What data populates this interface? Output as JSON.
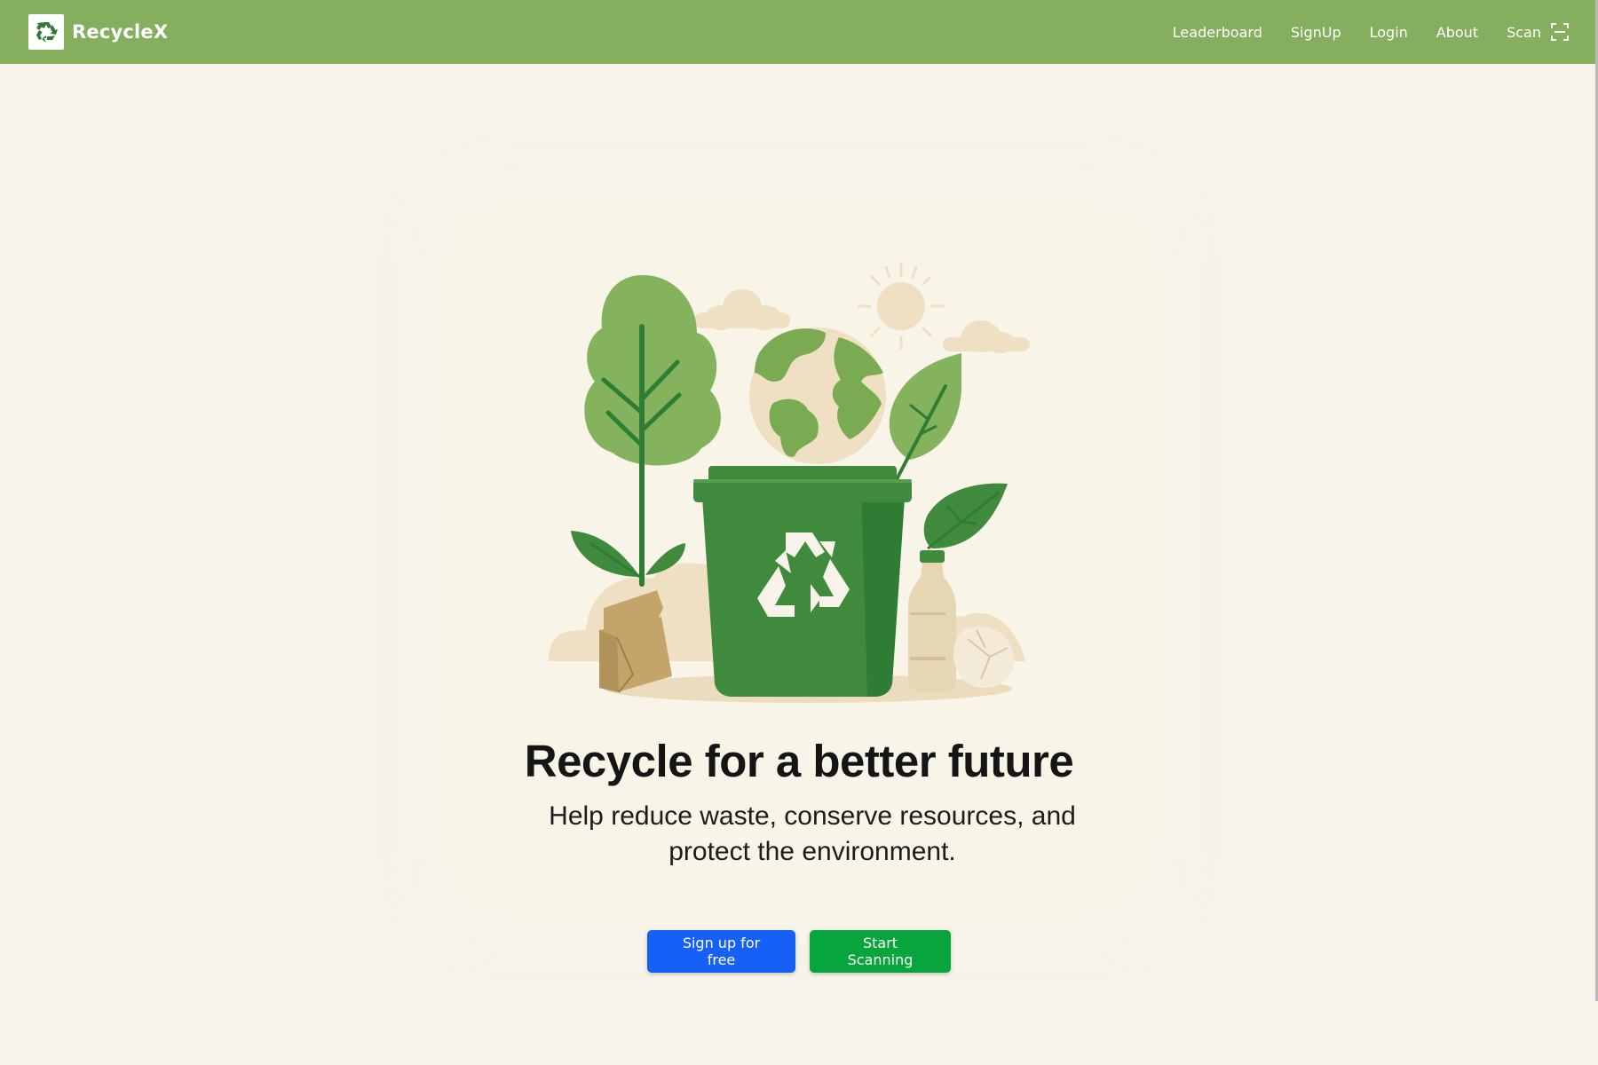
{
  "brand": {
    "name": "RecycleX",
    "logo_icon": "recycle-icon"
  },
  "nav": {
    "items": [
      {
        "label": "Leaderboard"
      },
      {
        "label": "SignUp"
      },
      {
        "label": "Login"
      },
      {
        "label": "About"
      },
      {
        "label": "Scan",
        "icon": "scan-frame-icon"
      }
    ]
  },
  "hero": {
    "title": "Recycle for a better future",
    "subtitle": "Help reduce waste, conserve resources, and protect the environment."
  },
  "buttons": {
    "signup_label": "Sign up for free",
    "scan_label": "Start Scanning"
  },
  "colors": {
    "navbar": "#86ae5f",
    "background": "#f7f3ea",
    "signup_button": "#1760f5",
    "scan_button": "#08a43c",
    "bin_green": "#3f8a3c"
  }
}
